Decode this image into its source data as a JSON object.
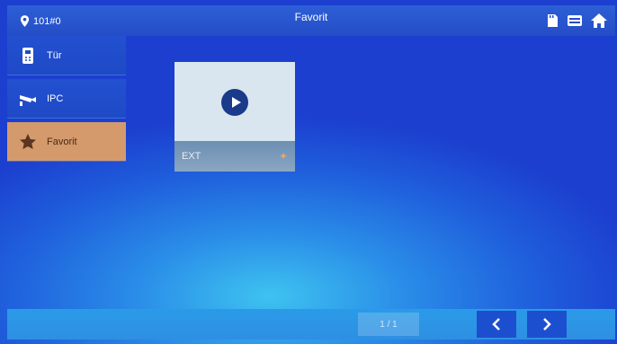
{
  "header": {
    "location": "101#0",
    "title": "Favorit"
  },
  "sidebar": {
    "items": [
      {
        "label": "Tür",
        "icon": "door-intercom-icon",
        "active": false
      },
      {
        "label": "IPC",
        "icon": "camera-icon",
        "active": false
      },
      {
        "label": "Favorit",
        "icon": "star-icon",
        "active": true
      }
    ]
  },
  "favorites": [
    {
      "name": "EXT",
      "icon": "play-icon",
      "pin_icon": "pin-icon"
    }
  ],
  "pagination": {
    "text": "1 / 1"
  },
  "colors": {
    "accent": "#d49a6c",
    "bar": "#244dc6"
  }
}
